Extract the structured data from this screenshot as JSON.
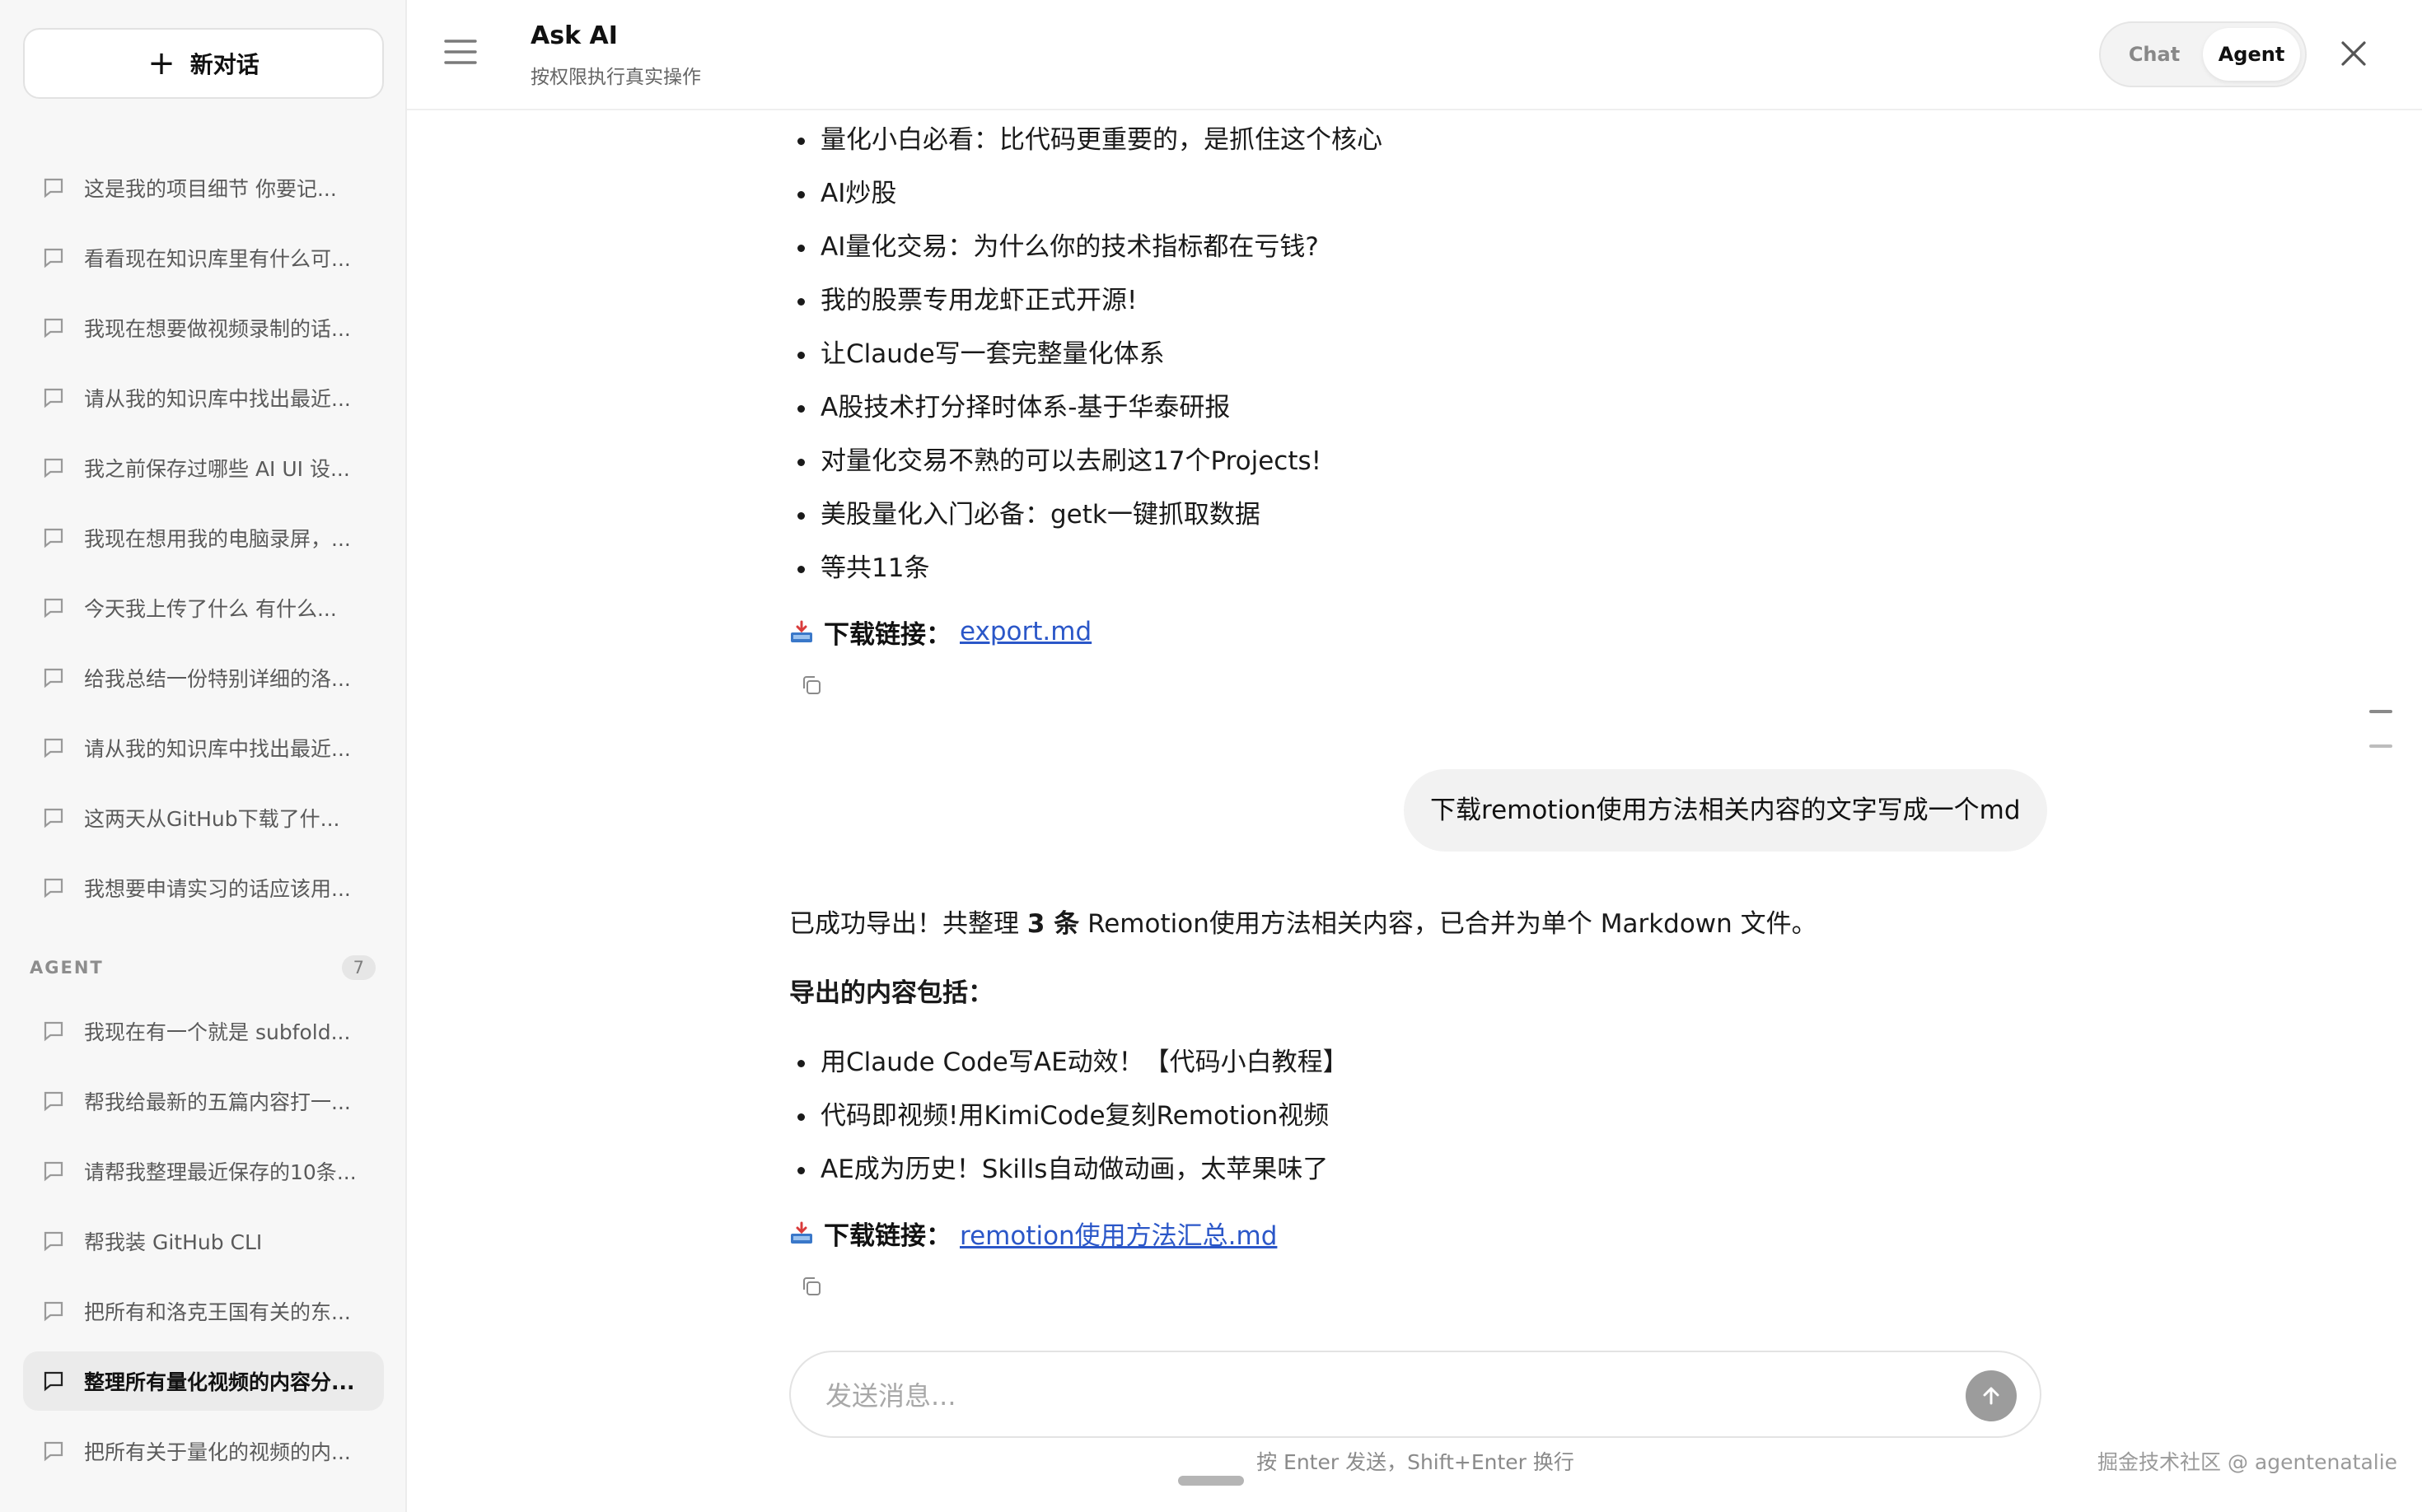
{
  "sidebar": {
    "new_chat_label": "新对话",
    "chat_history": [
      "这是我的项目细节 你要记...",
      "看看现在知识库里有什么可...",
      "我现在想要做视频录制的话...",
      "请从我的知识库中找出最近...",
      "我之前保存过哪些 AI UI 设...",
      "我现在想用我的电脑录屏，...",
      "今天我上传了什么 有什么...",
      "给我总结一份特别详细的洛...",
      "请从我的知识库中找出最近...",
      "这两天从GitHub下载了什...",
      "我想要申请实习的话应该用..."
    ],
    "agent_section_label": "AGENT",
    "agent_count": "7",
    "agent_history": [
      "我现在有一个就是 subfold...",
      "帮我给最新的五篇内容打一...",
      "请帮我整理最近保存的10条...",
      "帮我装 GitHub CLI",
      "把所有和洛克王国有关的东...",
      "整理所有量化视频的内容分...",
      "把所有关于量化的视频的内..."
    ]
  },
  "header": {
    "title": "Ask AI",
    "subtitle": "按权限执行真实操作",
    "mode_chat": "Chat",
    "mode_agent": "Agent"
  },
  "conversation": {
    "prev_bullets": [
      "量化小白必看：比代码更重要的，是抓住这个核心",
      "AI炒股",
      "AI量化交易：为什么你的技术指标都在亏钱?",
      "我的股票专用龙虾正式开源!",
      "让Claude写一套完整量化体系",
      "A股技术打分择时体系-基于华泰研报",
      "对量化交易不熟的可以去刷这17个Projects!",
      "美股量化入门必备：getk一键抓取数据",
      "等共11条"
    ],
    "download_label": "下载链接：",
    "prev_link": "export.md",
    "user_message": "下载remotion使用方法相关内容的文字写成一个md",
    "reply_intro_before": "已成功导出！共整理 ",
    "reply_intro_count": "3 条",
    "reply_intro_after": " Remotion使用方法相关内容，已合并为单个 Markdown 文件。",
    "reply_heading": "导出的内容包括：",
    "reply_bullets": [
      "用Claude Code写AE动效！【代码小白教程】",
      "代码即视频!用KimiCode复刻Remotion视频",
      "AE成为历史！Skills自动做动画，太苹果味了"
    ],
    "reply_link": "remotion使用方法汇总.md"
  },
  "composer": {
    "placeholder": "发送消息...",
    "hint": "按 Enter 发送，Shift+Enter 换行"
  },
  "watermark": "掘金技术社区 @ agentenatalie",
  "colors": {
    "link": "#2b57c8",
    "active_item": "#ebebeb",
    "send_button": "#9c9c9c"
  }
}
